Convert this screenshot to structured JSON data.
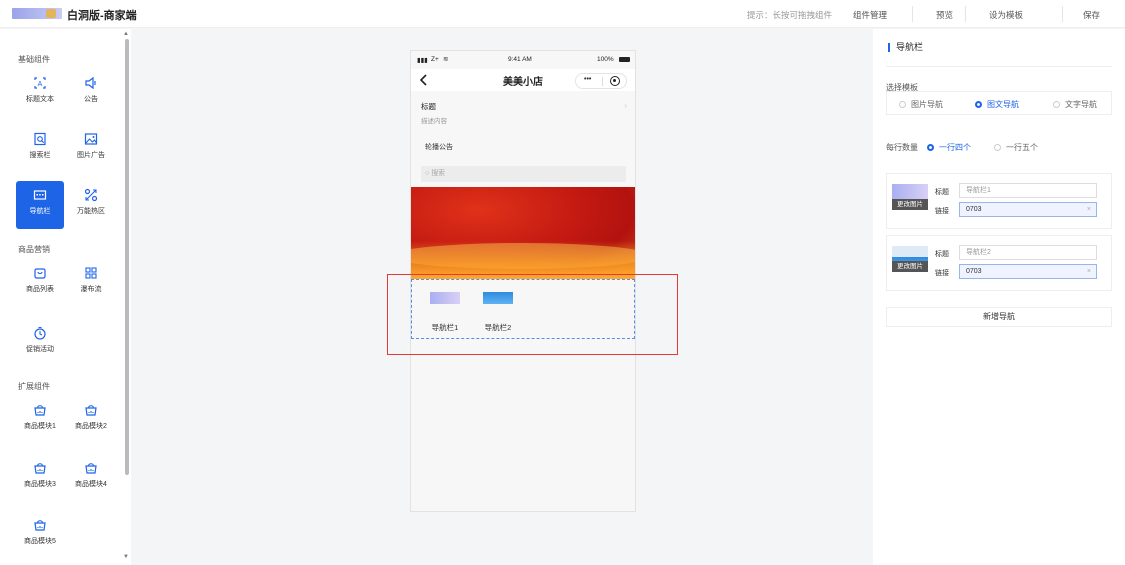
{
  "app": {
    "title": "白洞版-商家端"
  },
  "topbar": {
    "hint": "提示：长按可拖拽组件",
    "component_manage": "组件管理",
    "preview": "预览",
    "set_template": "设为模板",
    "save": "保存"
  },
  "sidebar": {
    "basic_title": "基础组件",
    "marketing_title": "商品营销",
    "extend_title": "扩展组件",
    "items": {
      "title_text": "标题文本",
      "notice": "公告",
      "search_bar": "搜索栏",
      "image_ad": "图片广告",
      "nav_bar": "导航栏",
      "hotspot": "万能热区",
      "product_list": "商品列表",
      "waterfall": "瀑布流",
      "promotion": "促销活动",
      "module1": "商品模块1",
      "module2": "商品模块2",
      "module3": "商品模块3",
      "module4": "商品模块4",
      "module5": "商品模块5"
    }
  },
  "phone": {
    "signal": "Z+",
    "time": "9:41 AM",
    "battery": "100%",
    "shop_name": "美美小店",
    "more": "•••",
    "title": "标题",
    "desc": "描述内容",
    "notice": "轮播公告",
    "search_placeholder": "搜索",
    "nav_items": [
      "导航栏1",
      "导航栏2"
    ]
  },
  "panel": {
    "title": "导航栏",
    "choose_template": "选择模板",
    "templates": [
      "图片导航",
      "图文导航",
      "文字导航"
    ],
    "selected_template": "图文导航",
    "per_row_label": "每行数量",
    "per_row_options": [
      "一行四个",
      "一行五个"
    ],
    "selected_per_row": "一行四个",
    "field_title": "标题",
    "field_link": "链接",
    "change_image": "更改图片",
    "nav_entries": [
      {
        "title_placeholder": "导航栏1",
        "link": "0703"
      },
      {
        "title_placeholder": "导航栏2",
        "link": "0703"
      }
    ],
    "add_nav": "新增导航",
    "clear": "×"
  },
  "colors": {
    "accent": "#1e64e6",
    "highlight_box": "#e53935"
  }
}
